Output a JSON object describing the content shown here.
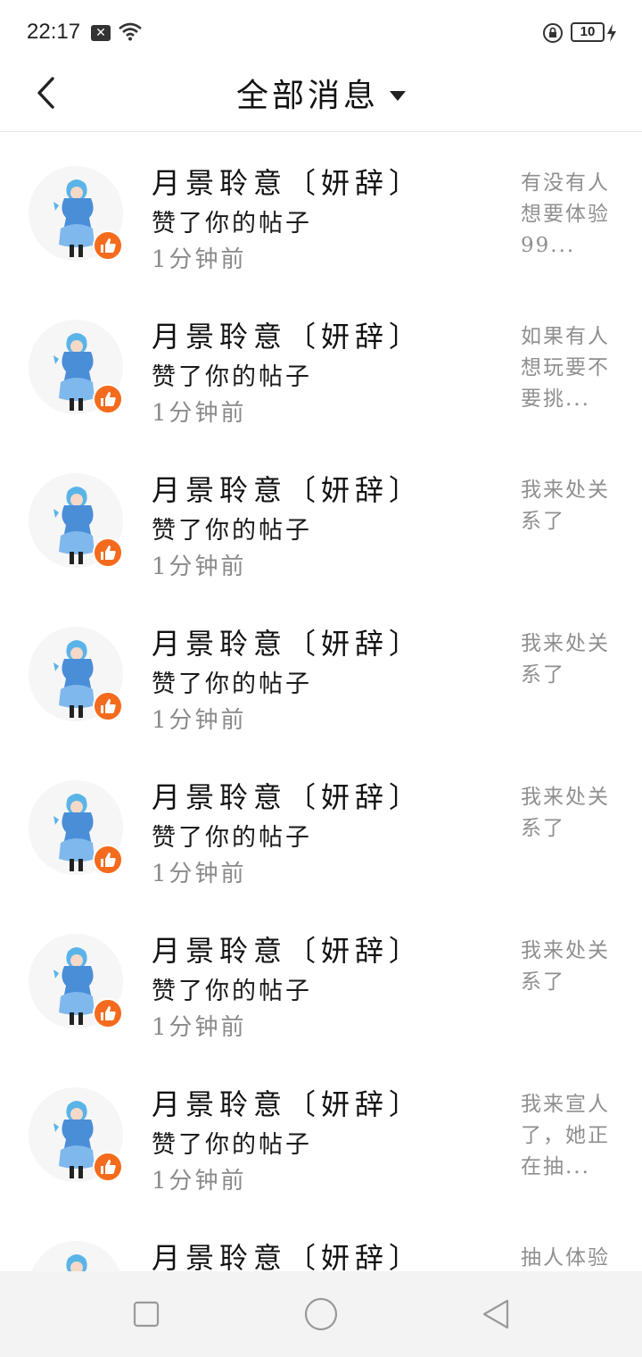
{
  "status_bar": {
    "time": "22:17",
    "battery": "10"
  },
  "header": {
    "title": "全部消息"
  },
  "notifications": [
    {
      "user": "月景聆意〔妍辞〕",
      "action": "赞了你的帖子",
      "time": "1分钟前",
      "preview": "有没有人想要体验99..."
    },
    {
      "user": "月景聆意〔妍辞〕",
      "action": "赞了你的帖子",
      "time": "1分钟前",
      "preview": "如果有人想玩要不要挑..."
    },
    {
      "user": "月景聆意〔妍辞〕",
      "action": "赞了你的帖子",
      "time": "1分钟前",
      "preview": "我来处关系了"
    },
    {
      "user": "月景聆意〔妍辞〕",
      "action": "赞了你的帖子",
      "time": "1分钟前",
      "preview": "我来处关系了"
    },
    {
      "user": "月景聆意〔妍辞〕",
      "action": "赞了你的帖子",
      "time": "1分钟前",
      "preview": "我来处关系了"
    },
    {
      "user": "月景聆意〔妍辞〕",
      "action": "赞了你的帖子",
      "time": "1分钟前",
      "preview": "我来处关系了"
    },
    {
      "user": "月景聆意〔妍辞〕",
      "action": "赞了你的帖子",
      "time": "1分钟前",
      "preview": "我来宣人了，她正在抽..."
    },
    {
      "user": "月景聆意〔妍辞〕",
      "action": "",
      "time": "",
      "preview": "抽人体验"
    }
  ],
  "icons": {
    "like": "thumbs-up-icon",
    "back": "chevron-left-icon",
    "dropdown": "caret-down-icon"
  },
  "colors": {
    "like_badge": "#f46b1d",
    "nav_bar": "#f3f3f3"
  }
}
